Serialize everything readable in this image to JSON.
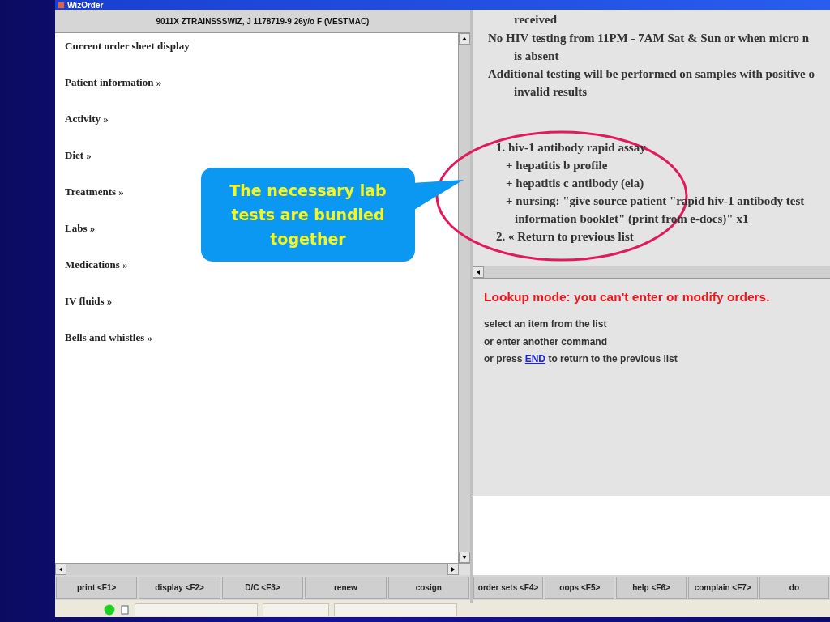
{
  "window": {
    "title": "WizOrder"
  },
  "patient_header": "9011X ZTRAINSSSWIZ, J 1178719-9 26y/o F (VESTMAC)",
  "menu_items": [
    "Current order sheet display",
    "Patient information »",
    "Activity »",
    "Diet »",
    "Treatments »",
    "Labs »",
    "Medications »",
    "IV fluids »",
    "Bells and whistles »"
  ],
  "order_lines": [
    {
      "kind": "cont",
      "text": "received"
    },
    {
      "kind": "note",
      "text": "No HIV testing from 11PM - 7AM Sat & Sun or when micro n"
    },
    {
      "kind": "cont",
      "text": "is absent"
    },
    {
      "kind": "note",
      "text": "Additional testing will be performed on samples with positive o"
    },
    {
      "kind": "cont",
      "text": "invalid results"
    },
    {
      "kind": "item_spaced",
      "text": "1. hiv-1 antibody rapid assay"
    },
    {
      "kind": "sub",
      "text": "+ hepatitis b profile"
    },
    {
      "kind": "sub",
      "text": "+ hepatitis c antibody (eia)"
    },
    {
      "kind": "sub",
      "text": "+ nursing: \"give source patient \"rapid hiv-1 antibody test"
    },
    {
      "kind": "subcont",
      "text": "information booklet\" (print from e-docs)\" x1"
    },
    {
      "kind": "item",
      "text": "2. « Return to previous list"
    }
  ],
  "lookup": {
    "message": "Lookup mode: you can't enter or modify orders.",
    "instructions": [
      "select an item from the list",
      "or enter another command"
    ],
    "end_instruction": {
      "before": "or press",
      "link": "END",
      "after": "to return to the previous list"
    }
  },
  "left_buttons": [
    "print  <F1>",
    "display  <F2>",
    "D/C  <F3>",
    "renew",
    "cosign"
  ],
  "right_buttons": [
    "order sets <F4>",
    "oops  <F5>",
    "help  <F6>",
    "complain <F7>",
    "do"
  ],
  "callout": {
    "text": "The necessary lab tests are bundled together"
  }
}
